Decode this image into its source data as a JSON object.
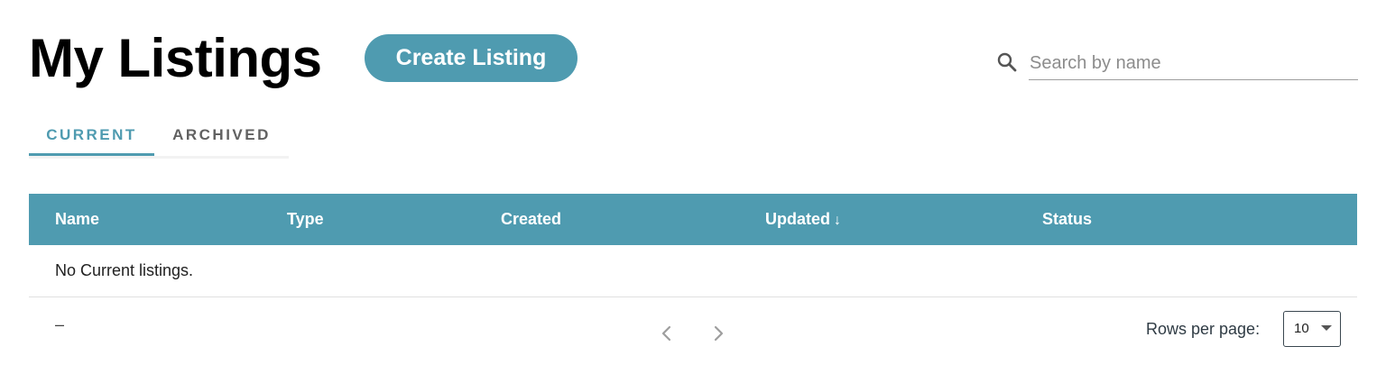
{
  "header": {
    "title": "My Listings",
    "create_button_label": "Create Listing"
  },
  "search": {
    "placeholder": "Search by name",
    "value": "",
    "icon": "search-icon"
  },
  "tabs": [
    {
      "label": "CURRENT",
      "active": true
    },
    {
      "label": "ARCHIVED",
      "active": false
    }
  ],
  "table": {
    "columns": [
      "Name",
      "Type",
      "Created",
      "Updated",
      "Status"
    ],
    "sorted_column": "Updated",
    "sort_direction": "descending",
    "sort_icon": "↓",
    "empty_message": "No Current listings."
  },
  "pagination": {
    "range_text": "–",
    "prev_icon": "chevron-left-icon",
    "next_icon": "chevron-right-icon",
    "rows_per_page_label": "Rows per page:",
    "rows_per_page_value": "10"
  },
  "colors": {
    "accent": "#4f9bb0",
    "header_text": "#ffffff",
    "title": "#000000"
  }
}
